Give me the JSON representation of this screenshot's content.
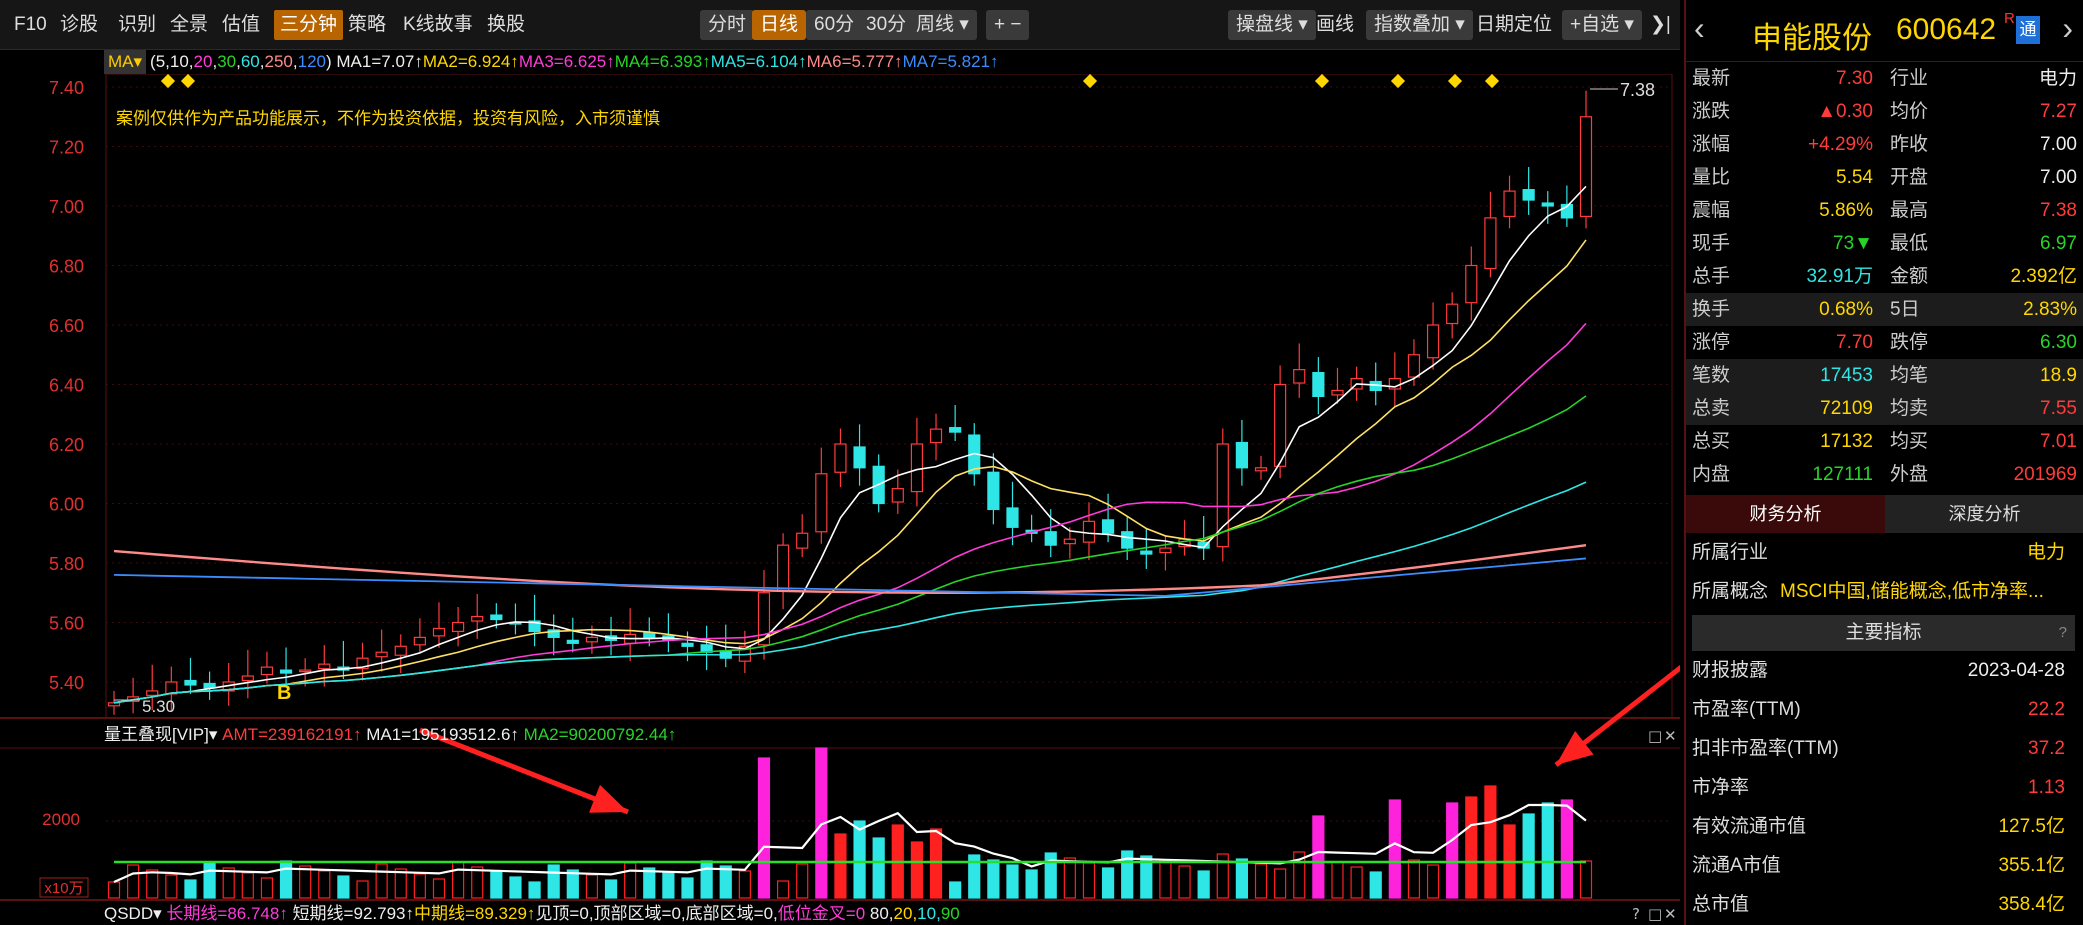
{
  "toolbar": {
    "left": [
      "F10",
      "诊股",
      "识别",
      "全景",
      "估值",
      "三分钟",
      "策略",
      "K线故事",
      "换股"
    ],
    "active_left": "三分钟",
    "periods": [
      "分时",
      "日线",
      "60分",
      "30分",
      "周线 ▾",
      "+ −"
    ],
    "active_period": "日线",
    "right": [
      "操盘线 ▾",
      "画线",
      "指数叠加 ▾",
      "日期定位",
      "+自选 ▾",
      "❯|"
    ]
  },
  "ma_legend": {
    "button": "MA▾",
    "params_prefix": "(5,10,",
    "params_20": "20",
    "params_comma": ",",
    "params_30": "30",
    "params_60": "60",
    "params_250": "250",
    "params_120": "120",
    "params_suffix": ")",
    "ma1": "MA1=7.07↑",
    "ma2": "MA2=6.924↑",
    "ma3": "MA3=6.625↑",
    "ma4": "MA4=6.393↑",
    "ma5": "MA5=6.104↑",
    "ma6": "MA6=5.777↑",
    "ma7": "MA7=5.821↑"
  },
  "disclaimer": "案例仅供作为产品功能展示，不作为投资依据，投资有风险，入市须谨慎",
  "high_label": "7.38",
  "low_label": "5.30",
  "buy_marker": "B",
  "y_ticks": [
    "7.40",
    "7.20",
    "7.00",
    "6.80",
    "6.60",
    "6.40",
    "6.20",
    "6.00",
    "5.80",
    "5.60",
    "5.40"
  ],
  "vol_header": {
    "name": "量王叠现[VIP]▾",
    "amt": "AMT=239162191↑",
    "ma1": "MA1=195193512.6↑",
    "ma2": "MA2=90200792.44↑"
  },
  "vol_ticks": {
    "t2000": "2000",
    "unit": "x10万"
  },
  "qsdd": {
    "name": "QSDD▾",
    "long": "长期线=86.748↑",
    "short": "短期线=92.793↑",
    "mid": "中期线=89.329↑",
    "top": "见顶=0,",
    "topzone": "顶部区域=0,",
    "bottomzone": "底部区域=0,",
    "lowcross": "低位金叉=0",
    "n80": "80,",
    "n20": "20,",
    "n10": "10,",
    "n90": "90"
  },
  "stock": {
    "name": "申能股份",
    "code": "600642",
    "r": "R",
    "tong": "通"
  },
  "quote": [
    {
      "l": "最新",
      "v": "7.30",
      "vc": "red",
      "l2": "行业",
      "v2": "电力",
      "v2c": "wht"
    },
    {
      "l": "涨跌",
      "v": "▲0.30",
      "vc": "red",
      "l2": "均价",
      "v2": "7.27",
      "v2c": "red"
    },
    {
      "l": "涨幅",
      "v": "+4.29%",
      "vc": "red",
      "l2": "昨收",
      "v2": "7.00",
      "v2c": "wht"
    },
    {
      "l": "量比",
      "v": "5.54",
      "vc": "yel",
      "l2": "开盘",
      "v2": "7.00",
      "v2c": "wht"
    },
    {
      "l": "震幅",
      "v": "5.86%",
      "vc": "yel",
      "l2": "最高",
      "v2": "7.38",
      "v2c": "red"
    },
    {
      "l": "现手",
      "v": "73▼",
      "vc": "grn",
      "l2": "最低",
      "v2": "6.97",
      "v2c": "grn"
    },
    {
      "l": "总手",
      "v": "32.91万",
      "vc": "cyn",
      "l2": "金额",
      "v2": "2.392亿",
      "v2c": "yel"
    },
    {
      "l": "换手",
      "v": "0.68%",
      "vc": "yel",
      "l2": "5日",
      "v2": "2.83%",
      "v2c": "yel",
      "hl": true
    },
    {
      "l": "涨停",
      "v": "7.70",
      "vc": "red",
      "l2": "跌停",
      "v2": "6.30",
      "v2c": "grn"
    },
    {
      "l": "笔数",
      "v": "17453",
      "vc": "cyn",
      "l2": "均笔",
      "v2": "18.9",
      "v2c": "yel",
      "hl": true
    },
    {
      "l": "总卖",
      "v": "72109",
      "vc": "yel",
      "l2": "均卖",
      "v2": "7.55",
      "v2c": "red",
      "hl": true
    },
    {
      "l": "总买",
      "v": "17132",
      "vc": "yel",
      "l2": "均买",
      "v2": "7.01",
      "v2c": "red"
    },
    {
      "l": "内盘",
      "v": "127111",
      "vc": "grn",
      "l2": "外盘",
      "v2": "201969",
      "v2c": "red"
    }
  ],
  "fin_tabs": [
    "财务分析",
    "深度分析"
  ],
  "industry": {
    "l": "所属行业",
    "v": "电力"
  },
  "concept": {
    "l": "所属概念",
    "v": "MSCI中国,储能概念,低市净率..."
  },
  "main_ind": "主要指标",
  "fin_rows": [
    {
      "l": "财报披露",
      "v": "2023-04-28",
      "c": "wht"
    },
    {
      "l": "市盈率(TTM)",
      "v": "22.2",
      "c": "red"
    },
    {
      "l": "扣非市盈率(TTM)",
      "v": "37.2",
      "c": "red"
    },
    {
      "l": "市净率",
      "v": "1.13",
      "c": "red"
    },
    {
      "l": "有效流通市值",
      "v": "127.5亿",
      "c": "yel"
    },
    {
      "l": "流通A市值",
      "v": "355.1亿",
      "c": "yel"
    },
    {
      "l": "总市值",
      "v": "358.4亿",
      "c": "yel"
    }
  ],
  "chart_data": {
    "type": "candlestick",
    "y_axis_range": [
      5.3,
      7.4
    ],
    "last_close": 7.3,
    "high": 7.38,
    "low": 5.3,
    "closes": [
      5.33,
      5.35,
      5.37,
      5.4,
      5.39,
      5.38,
      5.4,
      5.42,
      5.45,
      5.43,
      5.44,
      5.46,
      5.44,
      5.48,
      5.5,
      5.52,
      5.55,
      5.58,
      5.6,
      5.62,
      5.61,
      5.6,
      5.57,
      5.55,
      5.53,
      5.55,
      5.54,
      5.56,
      5.55,
      5.54,
      5.52,
      5.5,
      5.48,
      5.52,
      5.7,
      5.86,
      5.9,
      6.1,
      6.2,
      6.12,
      6.0,
      6.05,
      6.2,
      6.25,
      6.24,
      6.1,
      5.98,
      5.92,
      5.9,
      5.86,
      5.88,
      5.94,
      5.9,
      5.85,
      5.83,
      5.85,
      5.88,
      5.85,
      6.2,
      6.12,
      6.12,
      6.4,
      6.45,
      6.36,
      6.38,
      6.42,
      6.38,
      6.42,
      6.5,
      6.6,
      6.67,
      6.8,
      6.96,
      7.05,
      7.02,
      7.0,
      6.96,
      7.3
    ],
    "ma_values": {
      "MA1": 7.07,
      "MA2": 6.924,
      "MA3": 6.625,
      "MA4": 6.393,
      "MA5": 6.104,
      "MA6": 5.777,
      "MA7": 5.821
    }
  }
}
